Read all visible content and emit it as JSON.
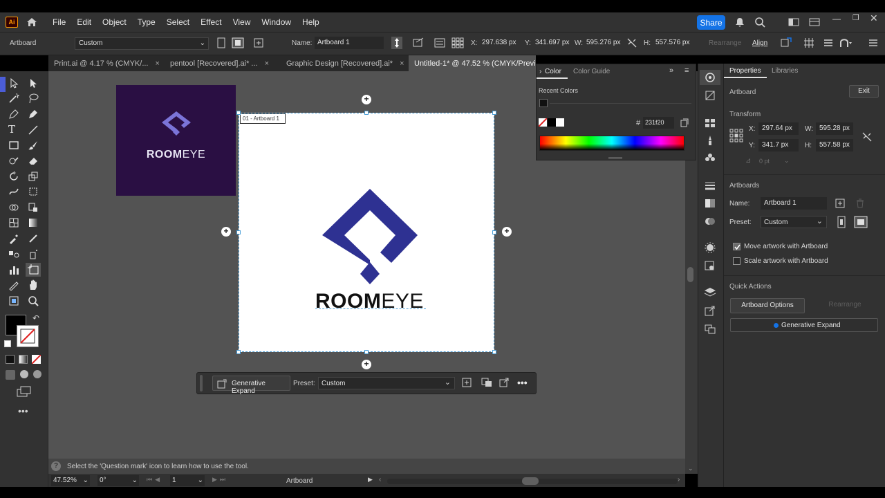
{
  "app": {
    "logo": "Ai"
  },
  "menu": [
    "File",
    "Edit",
    "Object",
    "Type",
    "Select",
    "Effect",
    "View",
    "Window",
    "Help"
  ],
  "share_label": "Share",
  "control": {
    "mode": "Artboard",
    "preset": "Custom",
    "name_label": "Name:",
    "name_value": "Artboard 1",
    "x_label": "X:",
    "x_value": "297.638 px",
    "y_label": "Y:",
    "y_value": "341.697 px",
    "w_label": "W:",
    "w_value": "595.276 px",
    "h_label": "H:",
    "h_value": "557.576 px",
    "rearrange": "Rearrange",
    "align": "Align"
  },
  "tabs": [
    {
      "label": "Print.ai @ 4.17 % (CMYK/...",
      "active": false
    },
    {
      "label": "pentool [Recovered].ai* ...",
      "active": false
    },
    {
      "label": "Graphic Design [Recovered].ai*",
      "active": false
    },
    {
      "label": "Untitled-1* @ 47.52 % (CMYK/Previ",
      "active": true
    }
  ],
  "tab_close": "×",
  "artboard": {
    "label": "01 - Artboard 1",
    "logo_text_a": "ROOM",
    "logo_text_b": "EYE",
    "logo_color": "#2e3192",
    "dark_bg": "#2a0f43",
    "dark_logo_color": "#7b74d8"
  },
  "context_bar": {
    "gen_expand": "Generative Expand",
    "preset_label": "Preset:",
    "preset_value": "Custom"
  },
  "status": {
    "hint": "Select the 'Question mark' icon to learn how to use the tool.",
    "zoom": "47.52%",
    "rotation": "0°",
    "artboard_num": "1",
    "tool_name": "Artboard"
  },
  "color_panel": {
    "tab_color": "Color",
    "tab_guide": "Color Guide",
    "recent": "Recent Colors",
    "hex_symbol": "#",
    "hex": "231f20"
  },
  "properties": {
    "tab_properties": "Properties",
    "tab_libraries": "Libraries",
    "section_artboard": "Artboard",
    "exit": "Exit",
    "transform": "Transform",
    "x_label": "X:",
    "x": "297.64 px",
    "y_label": "Y:",
    "y": "341.7 px",
    "w_label": "W:",
    "w": "595.28 px",
    "h_label": "H:",
    "h": "557.58 px",
    "angle": "0 pt",
    "artboards": "Artboards",
    "name_label": "Name:",
    "name": "Artboard 1",
    "preset_label": "Preset:",
    "preset": "Custom",
    "move_artwork": "Move artwork with Artboard",
    "scale_artwork": "Scale artwork with Artboard",
    "quick_actions": "Quick Actions",
    "artboard_options": "Artboard Options",
    "rearrange": "Rearrange",
    "generative_expand": "Generative Expand"
  },
  "colors": {
    "accent": "#1473e6",
    "selection": "#4a9fd8"
  }
}
